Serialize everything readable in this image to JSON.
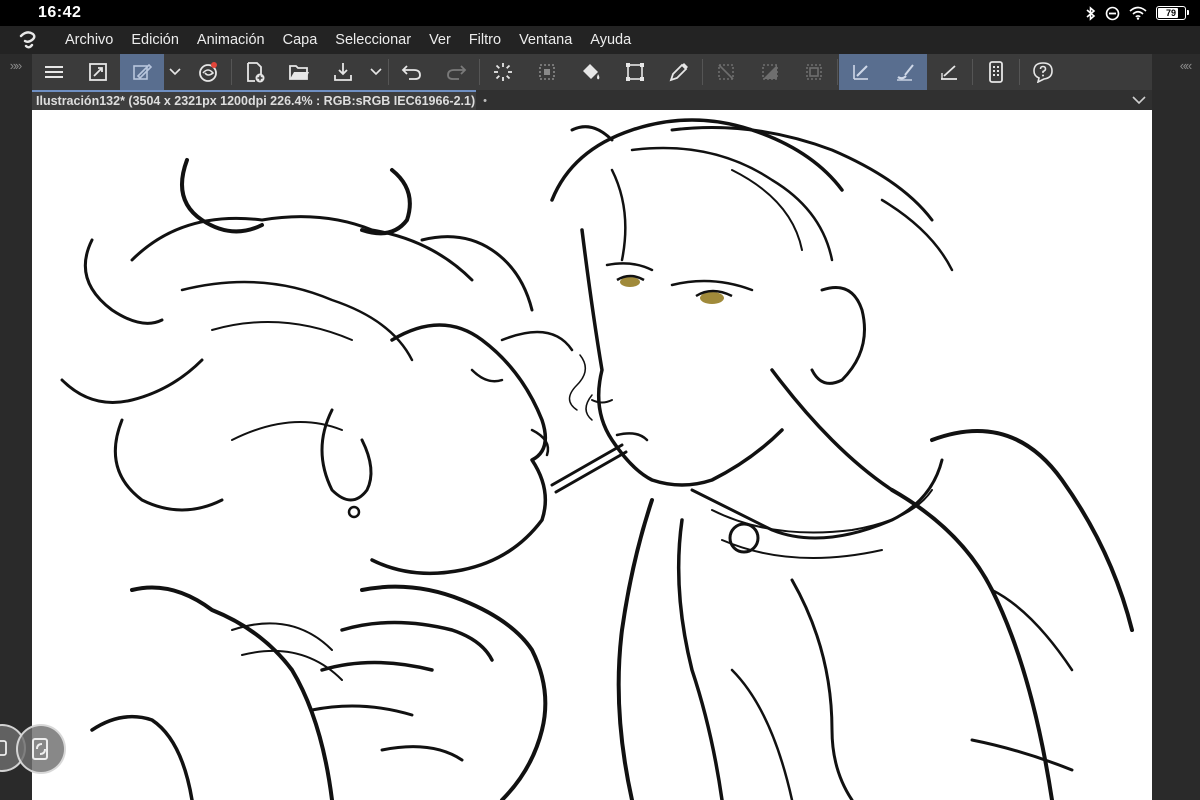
{
  "status_bar": {
    "time": "16:42",
    "battery_level": "79",
    "icons": [
      "bluetooth-icon",
      "do-not-disturb-icon",
      "wifi-icon",
      "battery-icon"
    ]
  },
  "menu_bar": {
    "logo_icon": "clip-studio-logo-icon",
    "items": [
      "Archivo",
      "Edición",
      "Animación",
      "Capa",
      "Seleccionar",
      "Ver",
      "Filtro",
      "Ventana",
      "Ayuda"
    ]
  },
  "toolbar": {
    "icons": [
      "hamburger-menu-icon",
      "fit-screen-icon",
      "quick-access-brush-icon",
      "dropdown-chevron-icon",
      "companion-mode-icon",
      "new-canvas-icon",
      "open-folder-icon",
      "save-download-icon",
      "dropdown-chevron-icon",
      "undo-icon",
      "redo-icon",
      "auto-select-icon",
      "selection-area-icon",
      "fill-bucket-icon",
      "transform-icon",
      "eyedropper-icon",
      "clear-selection-icon",
      "invert-selection-icon",
      "show-selection-icon",
      "pen-stabilize-icon",
      "brush-stroke-icon",
      "ruler-pen-icon",
      "device-icon",
      "help-icon"
    ],
    "active_indices": [
      2,
      19,
      20
    ]
  },
  "document": {
    "title": "Ilustración132* (3504 x 2321px 1200dpi 226.4% : RGB:sRGB IEC61966-2.1)",
    "modified_dot": "•"
  },
  "colors": {
    "accent": "#6f8fc2",
    "active_tool": "#596e8f",
    "toolbar_bg": "#3b3b3b",
    "menubar_bg": "#232323",
    "canvas_bg": "#ffffff",
    "eye_color": "#a08a3a"
  },
  "floating": {
    "left_icon": "side-handle-icon",
    "main_icon": "edge-keyboard-icon"
  }
}
